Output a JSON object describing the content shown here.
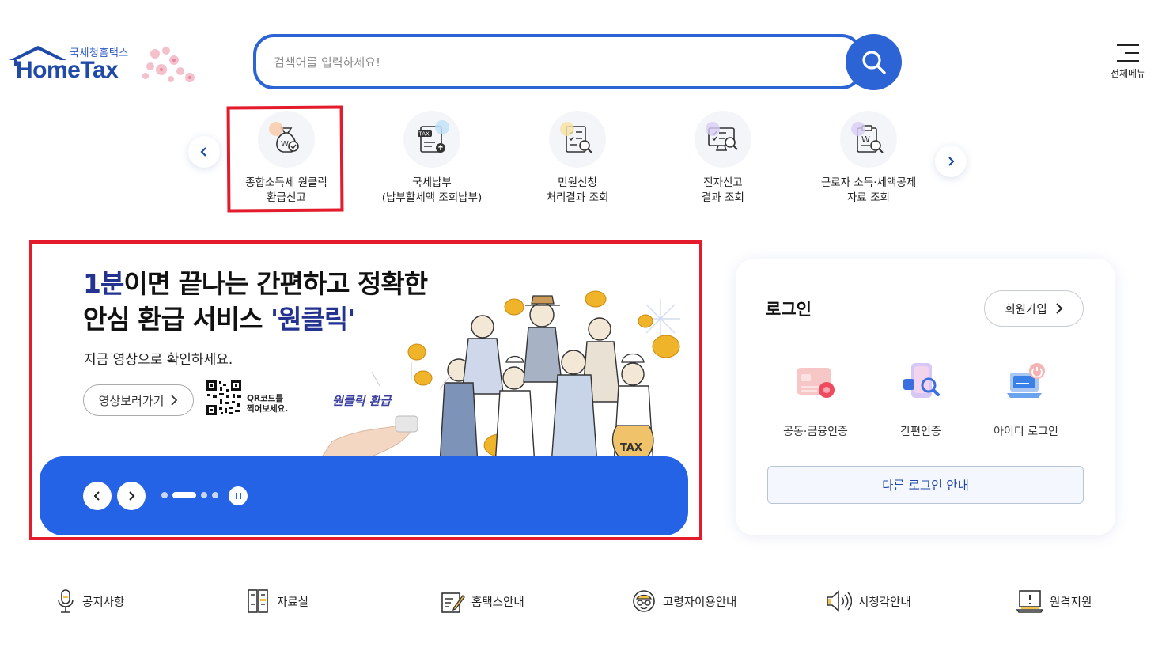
{
  "header": {
    "logo_sub": "국세청홈택스",
    "logo_main": "HomeTax",
    "search_placeholder": "검색어를 입력하세요!",
    "search_icon": "search-icon",
    "menu_label": "전체메뉴"
  },
  "quick_menu": {
    "items": [
      {
        "line1": "종합소득세 원클릭",
        "line2": "환급신고",
        "icon": "money-bag-check-icon",
        "accent": "#f7c9a6"
      },
      {
        "line1": "국세납부",
        "line2": "(납부할세액 조회납부)",
        "icon": "tax-document-upload-icon",
        "accent": "#bfe0f7"
      },
      {
        "line1": "민원신청",
        "line2": "처리결과 조회",
        "icon": "document-search-icon",
        "accent": "#f8e2a3"
      },
      {
        "line1": "전자신고",
        "line2": "결과 조회",
        "icon": "monitor-search-icon",
        "accent": "#d9cdf5"
      },
      {
        "line1": "근로자 소득·세액공제",
        "line2": "자료 조회",
        "icon": "clipboard-won-search-icon",
        "accent": "#d9cdf5"
      }
    ]
  },
  "banner": {
    "title_highlight": "1분",
    "title_line1_rest": "이면 끝나는 간편하고 정확한",
    "title_line2_prefix": "안심 환급 서비스 ",
    "title_line2_highlight": "'원클릭'",
    "subtitle": "지금 영상으로 확인하세요.",
    "video_button": "영상보러가기",
    "qr_text_line1": "QR코드를",
    "qr_text_line2": "찍어보세요.",
    "badge": "원클릭 환급",
    "art_label": "TAX",
    "slide_count": 4,
    "active_slide": 2,
    "accent": "#2563e6"
  },
  "login": {
    "title": "로그인",
    "signup": "회원가입",
    "options": [
      {
        "label": "공동·금융인증",
        "icon": "certificate-card-icon"
      },
      {
        "label": "간편인증",
        "icon": "phone-search-icon"
      },
      {
        "label": "아이디 로그인",
        "icon": "laptop-power-icon"
      }
    ],
    "other": "다른 로그인 안내"
  },
  "footer_links": [
    {
      "label": "공지사항",
      "icon": "microphone-icon"
    },
    {
      "label": "자료실",
      "icon": "file-cabinet-icon"
    },
    {
      "label": "홈택스안내",
      "icon": "edit-document-icon"
    },
    {
      "label": "고령자이용안내",
      "icon": "senior-icon"
    },
    {
      "label": "시청각안내",
      "icon": "speaker-icon"
    },
    {
      "label": "원격지원",
      "icon": "remote-monitor-icon"
    }
  ]
}
